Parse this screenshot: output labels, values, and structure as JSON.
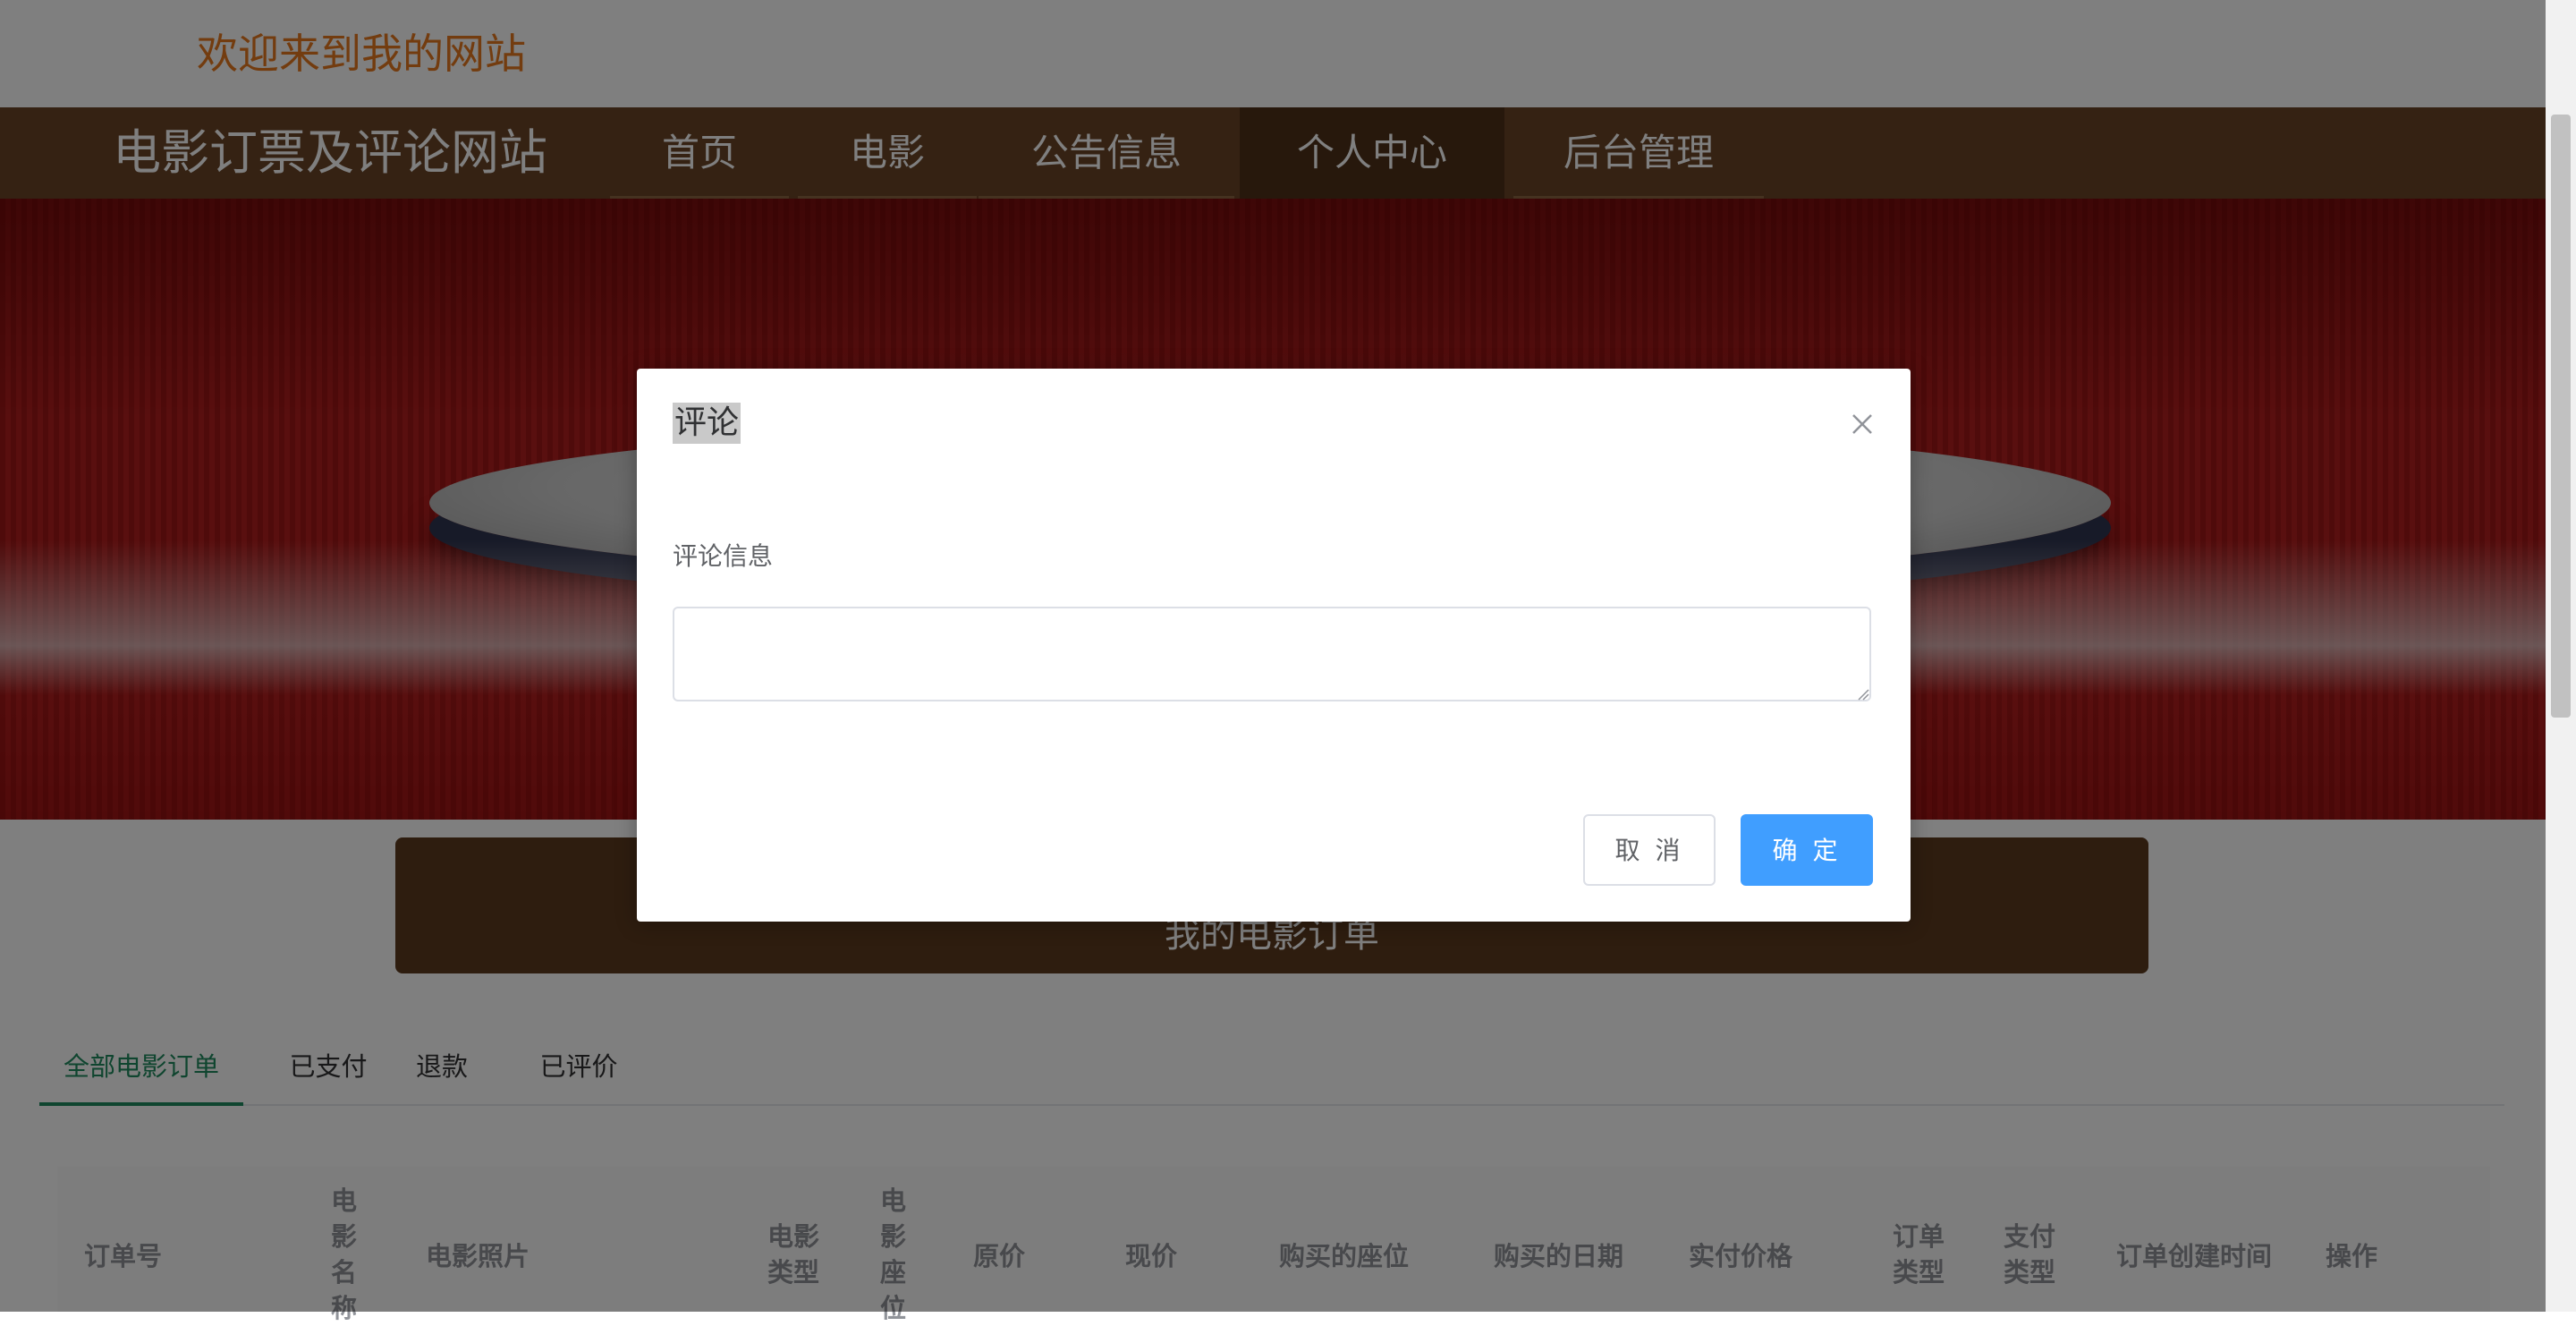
{
  "header": {
    "welcome": "欢迎来到我的网站"
  },
  "navbar": {
    "site_title": "电影订票及评论网站",
    "items": [
      {
        "label": "首页",
        "active": false
      },
      {
        "label": "电影",
        "active": false
      },
      {
        "label": "公告信息",
        "active": false
      },
      {
        "label": "个人中心",
        "active": true
      },
      {
        "label": "后台管理",
        "active": false
      }
    ]
  },
  "page": {
    "title": "我的电影订单"
  },
  "tabs": [
    {
      "label": "全部电影订单",
      "active": true
    },
    {
      "label": "已支付",
      "active": false
    },
    {
      "label": "退款",
      "active": false
    },
    {
      "label": "已评价",
      "active": false
    }
  ],
  "table": {
    "columns": [
      "订单号",
      "电\n影\n名\n称",
      "电影照片",
      "电影\n类型",
      "电\n影\n座\n位",
      "原价",
      "现价",
      "购买的座位",
      "购买的日期",
      "实付价格",
      "订单\n类型",
      "支付\n类型",
      "订单创建时间",
      "操作"
    ]
  },
  "dialog": {
    "title": "评论",
    "close_icon": "close-icon",
    "field_label": "评论信息",
    "textarea_value": "",
    "cancel_label": "取 消",
    "confirm_label": "确 定"
  },
  "colors": {
    "accent": "#e6781e",
    "nav_bg": "#6b4526",
    "nav_active": "#4e3019",
    "primary_button": "#409eff",
    "tab_active": "#1f8a5e"
  }
}
